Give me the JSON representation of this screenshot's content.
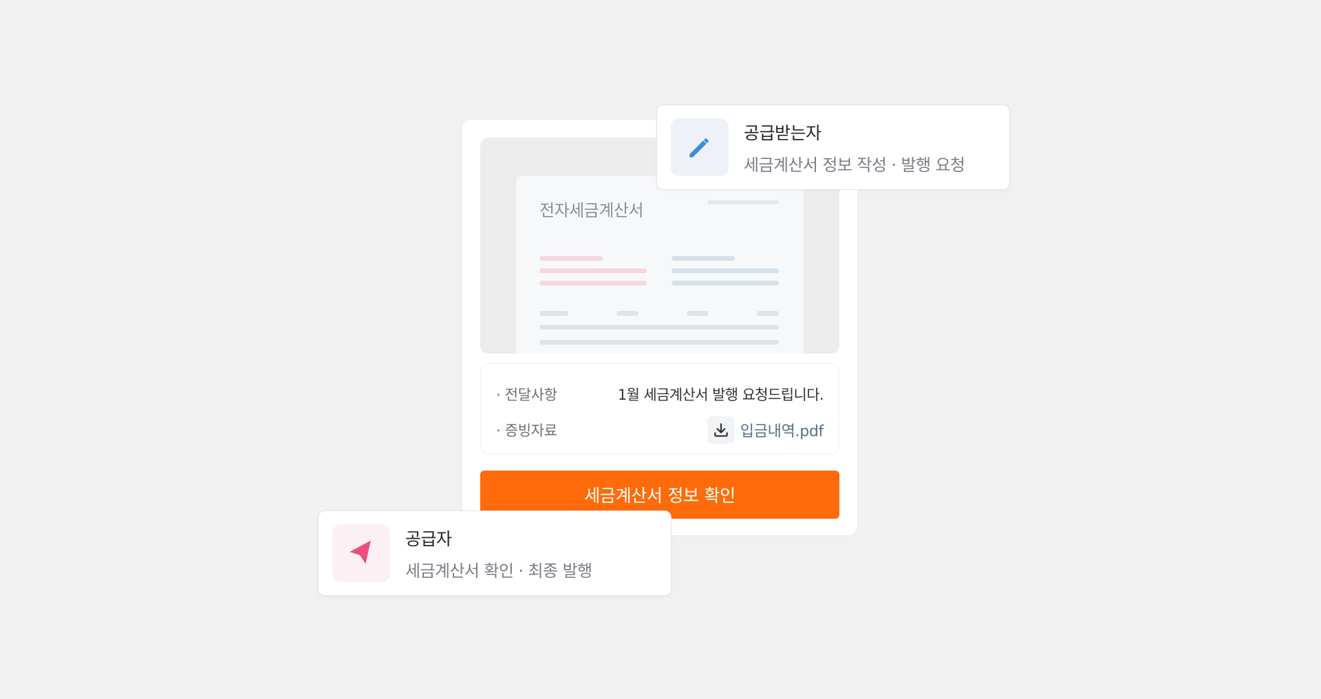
{
  "invoice": {
    "title": "전자세금계산서"
  },
  "info": {
    "message_label": "· 전달사항",
    "message_value": "1월 세금계산서 발행 요청드립니다.",
    "evidence_label": "· 증빙자료",
    "evidence_file": "입금내역.pdf"
  },
  "confirm_button": "세금계산서 정보 확인",
  "recipient_card": {
    "title": "공급받는자",
    "description": "세금계산서 정보 작성 · 발행 요청",
    "icon": "pencil-icon"
  },
  "supplier_card": {
    "title": "공급자",
    "description": "세금계산서 확인 · 최종 발행",
    "icon": "send-icon"
  },
  "colors": {
    "accent": "#ff6b0a",
    "recipient_icon": "#3b8ed8",
    "supplier_icon": "#ea4f80",
    "background": "#f1f1f1"
  }
}
